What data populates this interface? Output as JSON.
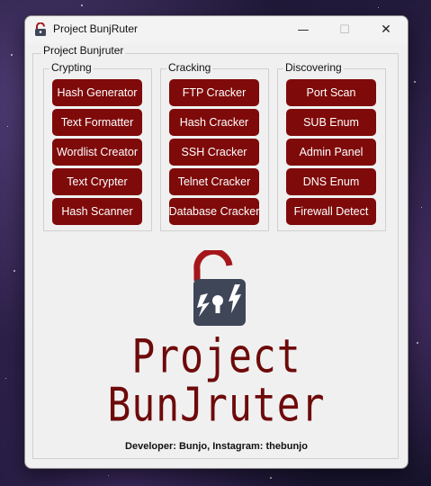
{
  "window": {
    "title": "Project BunjRuter",
    "minimize_glyph": "—",
    "maximize_glyph": "☐",
    "close_glyph": "✕"
  },
  "main_group": {
    "label": "Project Bunjruter"
  },
  "groups": [
    {
      "label": "Crypting",
      "buttons": [
        "Hash Generator",
        "Text Formatter",
        "Wordlist Creator",
        "Text Crypter",
        "Hash Scanner"
      ]
    },
    {
      "label": "Cracking",
      "buttons": [
        "FTP Cracker",
        "Hash Cracker",
        "SSH Cracker",
        "Telnet Cracker",
        "Database Cracker"
      ]
    },
    {
      "label": "Discovering",
      "buttons": [
        "Port Scan",
        "SUB Enum",
        "Admin Panel",
        "DNS Enum",
        "Firewall Detect"
      ]
    }
  ],
  "logo": {
    "line1": "Project",
    "line2": "BunJruter",
    "icon": "unlocked-padlock-icon"
  },
  "footer": {
    "developer": "Developer: Bunjo, Instagram: thebunjo"
  },
  "colors": {
    "button_bg": "#7f0a0a",
    "button_text": "#ffffff",
    "logo_red": "#6e0a0a",
    "lock_body": "#3f4658",
    "shackle": "#a5161b"
  }
}
